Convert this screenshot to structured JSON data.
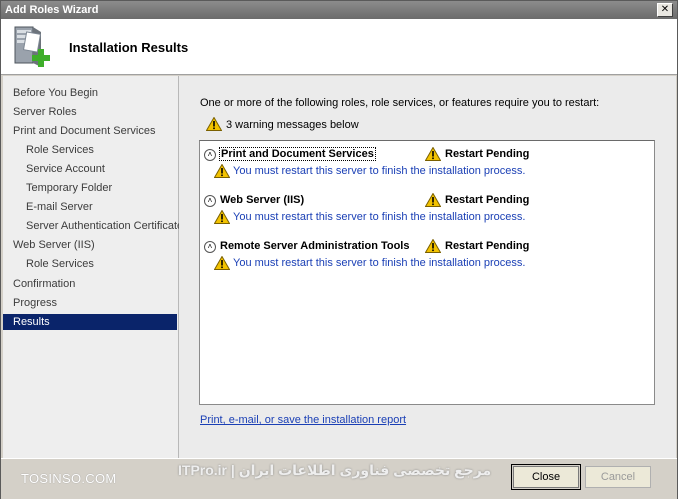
{
  "window": {
    "title": "Add Roles Wizard",
    "close_glyph": "✕"
  },
  "header": {
    "title": "Installation Results",
    "icon": "server-add-icon"
  },
  "sidebar": {
    "items": [
      {
        "label": "Before You Begin",
        "indent": false,
        "active": false
      },
      {
        "label": "Server Roles",
        "indent": false,
        "active": false
      },
      {
        "label": "Print and Document Services",
        "indent": false,
        "active": false
      },
      {
        "label": "Role Services",
        "indent": true,
        "active": false
      },
      {
        "label": "Service Account",
        "indent": true,
        "active": false
      },
      {
        "label": "Temporary Folder",
        "indent": true,
        "active": false
      },
      {
        "label": "E-mail Server",
        "indent": true,
        "active": false
      },
      {
        "label": "Server Authentication Certificate",
        "indent": true,
        "active": false
      },
      {
        "label": "Web Server (IIS)",
        "indent": false,
        "active": false
      },
      {
        "label": "Role Services",
        "indent": true,
        "active": false
      },
      {
        "label": "Confirmation",
        "indent": false,
        "active": false
      },
      {
        "label": "Progress",
        "indent": false,
        "active": false
      },
      {
        "label": "Results",
        "indent": false,
        "active": true
      }
    ]
  },
  "main": {
    "intro": "One or more of the following roles, role services, or features require you to restart:",
    "warning_summary": "3 warning messages below",
    "results": [
      {
        "role": "Print and Document Services",
        "status": "Restart Pending",
        "message": "You must restart this server to finish the installation process.",
        "expand_glyph": "˄"
      },
      {
        "role": "Web Server (IIS)",
        "status": "Restart Pending",
        "message": "You must restart this server to finish the installation process.",
        "expand_glyph": "˄"
      },
      {
        "role": "Remote Server Administration Tools",
        "status": "Restart Pending",
        "message": "You must restart this server to finish the installation process.",
        "expand_glyph": "˄"
      }
    ],
    "report_link": "Print, e-mail, or save the installation report"
  },
  "footer": {
    "close_label": "Close",
    "cancel_label": "Cancel",
    "watermark_left": "TOSINSO.COM",
    "watermark_center": "ITPro.ir | مرجع تخصصی فناوری اطلاعات ایران"
  },
  "colors": {
    "active_nav": "#0a246a",
    "link": "#1a3fb5",
    "warning": "#f2c200"
  }
}
